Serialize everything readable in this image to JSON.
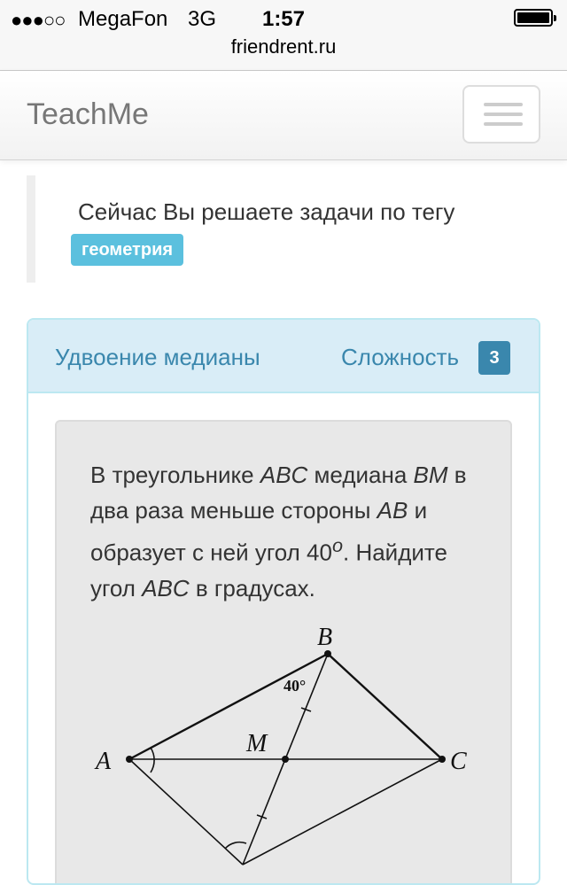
{
  "status_bar": {
    "signal": "●●●○○",
    "carrier": "MegaFon",
    "network": "3G",
    "time": "1:57",
    "url": "friendrent.ru"
  },
  "navbar": {
    "brand": "TeachMe",
    "menu_icon": "hamburger-icon"
  },
  "intro": {
    "text": "Сейчас Вы решаете задачи по тегу",
    "tag": "геометрия",
    "tag_color": "#5bc0de"
  },
  "task": {
    "title": "Удвоение медианы",
    "difficulty_label": "Сложность",
    "difficulty_value": "3",
    "accent_color": "#3a87ad",
    "problem": {
      "p1": "В треугольнике ",
      "abc1": "ABC",
      "p2": " медиана ",
      "bm": "BM",
      "p3": " в два раза меньше стороны ",
      "ab": "AB",
      "p4": " и образует с ней угол 40",
      "deg": "o",
      "p5": ". Найдите угол ",
      "abc2": "ABC",
      "p6": " в градусах."
    },
    "figure": {
      "label_a": "A",
      "label_b": "B",
      "label_c": "C",
      "label_m": "M",
      "angle_label": "40°"
    }
  }
}
